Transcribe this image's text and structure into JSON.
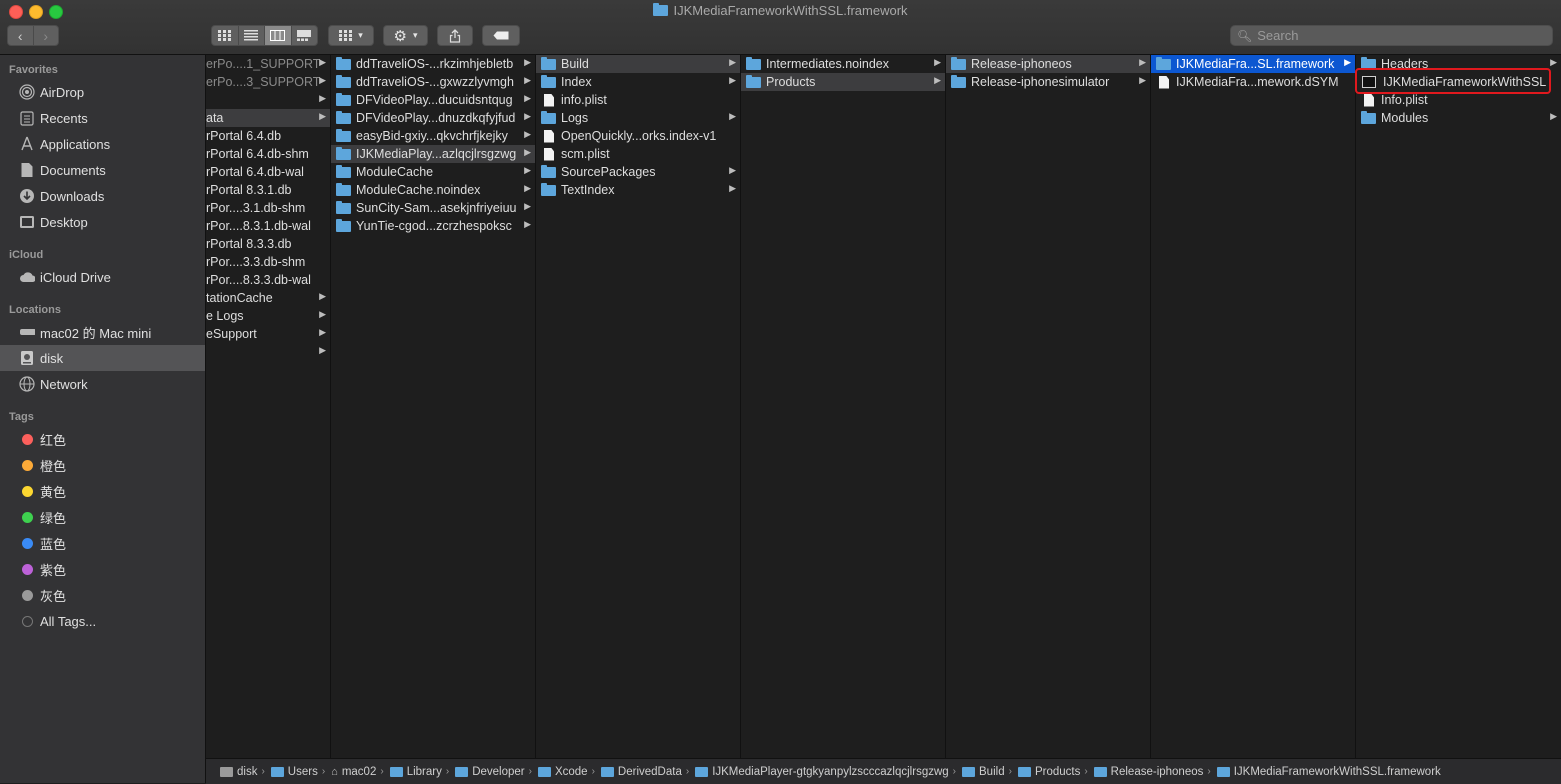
{
  "window": {
    "title": "IJKMediaFrameworkWithSSL.framework"
  },
  "toolbar": {
    "back_label": "‹",
    "forward_label": "›",
    "group_label": "▾",
    "action_label": "▾",
    "search_placeholder": "Search"
  },
  "sidebar": {
    "favorites_header": "Favorites",
    "favorites": [
      {
        "label": "AirDrop",
        "icon": "airdrop-icon"
      },
      {
        "label": "Recents",
        "icon": "recents-icon"
      },
      {
        "label": "Applications",
        "icon": "applications-icon"
      },
      {
        "label": "Documents",
        "icon": "documents-icon"
      },
      {
        "label": "Downloads",
        "icon": "downloads-icon"
      },
      {
        "label": "Desktop",
        "icon": "desktop-icon"
      }
    ],
    "icloud_header": "iCloud",
    "icloud": [
      {
        "label": "iCloud Drive",
        "icon": "cloud-icon"
      }
    ],
    "locations_header": "Locations",
    "locations": [
      {
        "label": "mac02 的 Mac mini",
        "icon": "computer-icon"
      },
      {
        "label": "disk",
        "icon": "disk-icon",
        "selected": true
      },
      {
        "label": "Network",
        "icon": "network-icon"
      }
    ],
    "tags_header": "Tags",
    "tags": [
      {
        "label": "红色",
        "color": "#fc605c"
      },
      {
        "label": "橙色",
        "color": "#fdaa38"
      },
      {
        "label": "黄色",
        "color": "#fcd731"
      },
      {
        "label": "绿色",
        "color": "#3ed14f"
      },
      {
        "label": "蓝色",
        "color": "#3a8bf6"
      },
      {
        "label": "紫色",
        "color": "#bd62d8"
      },
      {
        "label": "灰色",
        "color": "#9a9a9a"
      },
      {
        "label": "All Tags...",
        "color": "#555555"
      }
    ]
  },
  "columns": {
    "col1": [
      {
        "label": "erPo....1_SUPPORT",
        "arrow": true,
        "dim": true
      },
      {
        "label": "erPo....3_SUPPORT",
        "arrow": true,
        "dim": true
      },
      {
        "label": "",
        "arrow": true
      },
      {
        "label": "ata",
        "arrow": true,
        "sel": "inactive"
      },
      {
        "label": "rPortal 6.4.db"
      },
      {
        "label": "rPortal 6.4.db-shm"
      },
      {
        "label": "rPortal 6.4.db-wal"
      },
      {
        "label": "rPortal 8.3.1.db"
      },
      {
        "label": "rPor....3.1.db-shm"
      },
      {
        "label": "rPor....8.3.1.db-wal"
      },
      {
        "label": "rPortal 8.3.3.db"
      },
      {
        "label": "rPor....3.3.db-shm"
      },
      {
        "label": "rPor....8.3.3.db-wal"
      },
      {
        "label": "tationCache",
        "arrow": true
      },
      {
        "label": "e Logs",
        "arrow": true
      },
      {
        "label": "eSupport",
        "arrow": true
      },
      {
        "label": "",
        "arrow": true
      }
    ],
    "col2": [
      {
        "label": "ddTraveliOS-...rkzimhjebletb",
        "type": "folder",
        "arrow": true
      },
      {
        "label": "ddTraveliOS-...gxwzzlyvmgh",
        "type": "folder",
        "arrow": true
      },
      {
        "label": "DFVideoPlay...ducuidsntqug",
        "type": "folder",
        "arrow": true
      },
      {
        "label": "DFVideoPlay...dnuzdkqfyjfud",
        "type": "folder",
        "arrow": true
      },
      {
        "label": "easyBid-gxiy...qkvchrfjkejky",
        "type": "folder",
        "arrow": true
      },
      {
        "label": "IJKMediaPlay...azlqcjlrsgzwg",
        "type": "folder",
        "arrow": true,
        "sel": "inactive"
      },
      {
        "label": "ModuleCache",
        "type": "folder",
        "arrow": true
      },
      {
        "label": "ModuleCache.noindex",
        "type": "folder",
        "arrow": true
      },
      {
        "label": "SunCity-Sam...asekjnfriyeiuu",
        "type": "folder",
        "arrow": true
      },
      {
        "label": "YunTie-cgod...zcrzhespoksc",
        "type": "folder",
        "arrow": true
      }
    ],
    "col3": [
      {
        "label": "Build",
        "type": "folder",
        "arrow": true,
        "sel": "inactive"
      },
      {
        "label": "Index",
        "type": "folder",
        "arrow": true
      },
      {
        "label": "info.plist",
        "type": "doc"
      },
      {
        "label": "Logs",
        "type": "folder",
        "arrow": true
      },
      {
        "label": "OpenQuickly...orks.index-v1",
        "type": "doc"
      },
      {
        "label": "scm.plist",
        "type": "doc"
      },
      {
        "label": "SourcePackages",
        "type": "folder",
        "arrow": true
      },
      {
        "label": "TextIndex",
        "type": "folder",
        "arrow": true
      }
    ],
    "col4": [
      {
        "label": "Intermediates.noindex",
        "type": "folder",
        "arrow": true
      },
      {
        "label": "Products",
        "type": "folder",
        "arrow": true,
        "sel": "inactive"
      }
    ],
    "col5": [
      {
        "label": "Release-iphoneos",
        "type": "folder",
        "arrow": true,
        "sel": "inactive"
      },
      {
        "label": "Release-iphonesimulator",
        "type": "folder",
        "arrow": true
      }
    ],
    "col6": [
      {
        "label": "IJKMediaFra...SL.framework",
        "type": "folder",
        "arrow": true,
        "sel": "active"
      },
      {
        "label": "IJKMediaFra...mework.dSYM",
        "type": "doc"
      }
    ],
    "col7": [
      {
        "label": "Headers",
        "type": "folder",
        "arrow": true
      },
      {
        "label": "IJKMediaFrameworkWithSSL",
        "type": "exe"
      },
      {
        "label": "Info.plist",
        "type": "doc"
      },
      {
        "label": "Modules",
        "type": "folder",
        "arrow": true
      }
    ]
  },
  "pathbar": [
    {
      "label": "disk",
      "icon": "disk"
    },
    {
      "label": "Users",
      "icon": "folder"
    },
    {
      "label": "mac02",
      "icon": "home"
    },
    {
      "label": "Library",
      "icon": "folder"
    },
    {
      "label": "Developer",
      "icon": "folder"
    },
    {
      "label": "Xcode",
      "icon": "folder"
    },
    {
      "label": "DerivedData",
      "icon": "folder"
    },
    {
      "label": "IJKMediaPlayer-gtgkyanpylzscccazlqcjlrsgzwg",
      "icon": "folder"
    },
    {
      "label": "Build",
      "icon": "folder"
    },
    {
      "label": "Products",
      "icon": "folder"
    },
    {
      "label": "Release-iphoneos",
      "icon": "folder"
    },
    {
      "label": "IJKMediaFrameworkWithSSL.framework",
      "icon": "folder"
    }
  ]
}
